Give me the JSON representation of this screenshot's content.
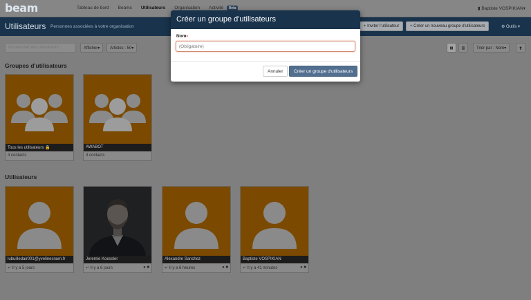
{
  "app": {
    "logo": "beam"
  },
  "nav": {
    "items": [
      "Tableau de bord",
      "Beams",
      "Utilisateurs",
      "Organisation",
      "Activité"
    ],
    "beta": "Beta",
    "user": "▮ Baptiste VOSPIKIAN▾"
  },
  "header": {
    "title": "Utilisateurs",
    "subtitle": "Personnes associées à votre organisation",
    "invite": "+ Inviter l'utilisateur",
    "new_group": "+ Créer un nouveau groupe d'utilisateurs",
    "tools": "⚙ Outils ▾"
  },
  "toolbar": {
    "search_placeholder": "Rechercher des utilisateurs",
    "show": "Afficher▾",
    "articles": "Articles : 50▾",
    "sort": "Trier par : Nom▾"
  },
  "groups": {
    "title": "Groupes d'utilisateurs",
    "cards": [
      {
        "name": "Tous les utilisateurs 🔒",
        "foot": "4 contacts"
      },
      {
        "name": "AWABOT",
        "foot": "3 contacts"
      }
    ]
  },
  "users": {
    "title": "Utilisateurs",
    "cards": [
      {
        "name": "lubuilledair001@yvelinesnum.fr",
        "foot": "↵ Il y a 5 jours",
        "badges": ""
      },
      {
        "name": "Jeremie Koessler",
        "foot": "↵ Il y a 6 jours",
        "badges": "● ■"
      },
      {
        "name": "Alexandre Sanchez",
        "foot": "↵ Il y a 6 heures",
        "badges": "● ■"
      },
      {
        "name": "Baptiste VOSPIKIAN",
        "foot": "↵ Il y a 41 minutes",
        "badges": "● ■"
      }
    ]
  },
  "modal": {
    "title": "Créer un groupe d'utilisateurs",
    "label": "Nom",
    "required_mark": "•",
    "placeholder": "(Obligatoire)",
    "cancel": "Annuler",
    "submit": "Créer un groupe d'utilisateurs"
  }
}
